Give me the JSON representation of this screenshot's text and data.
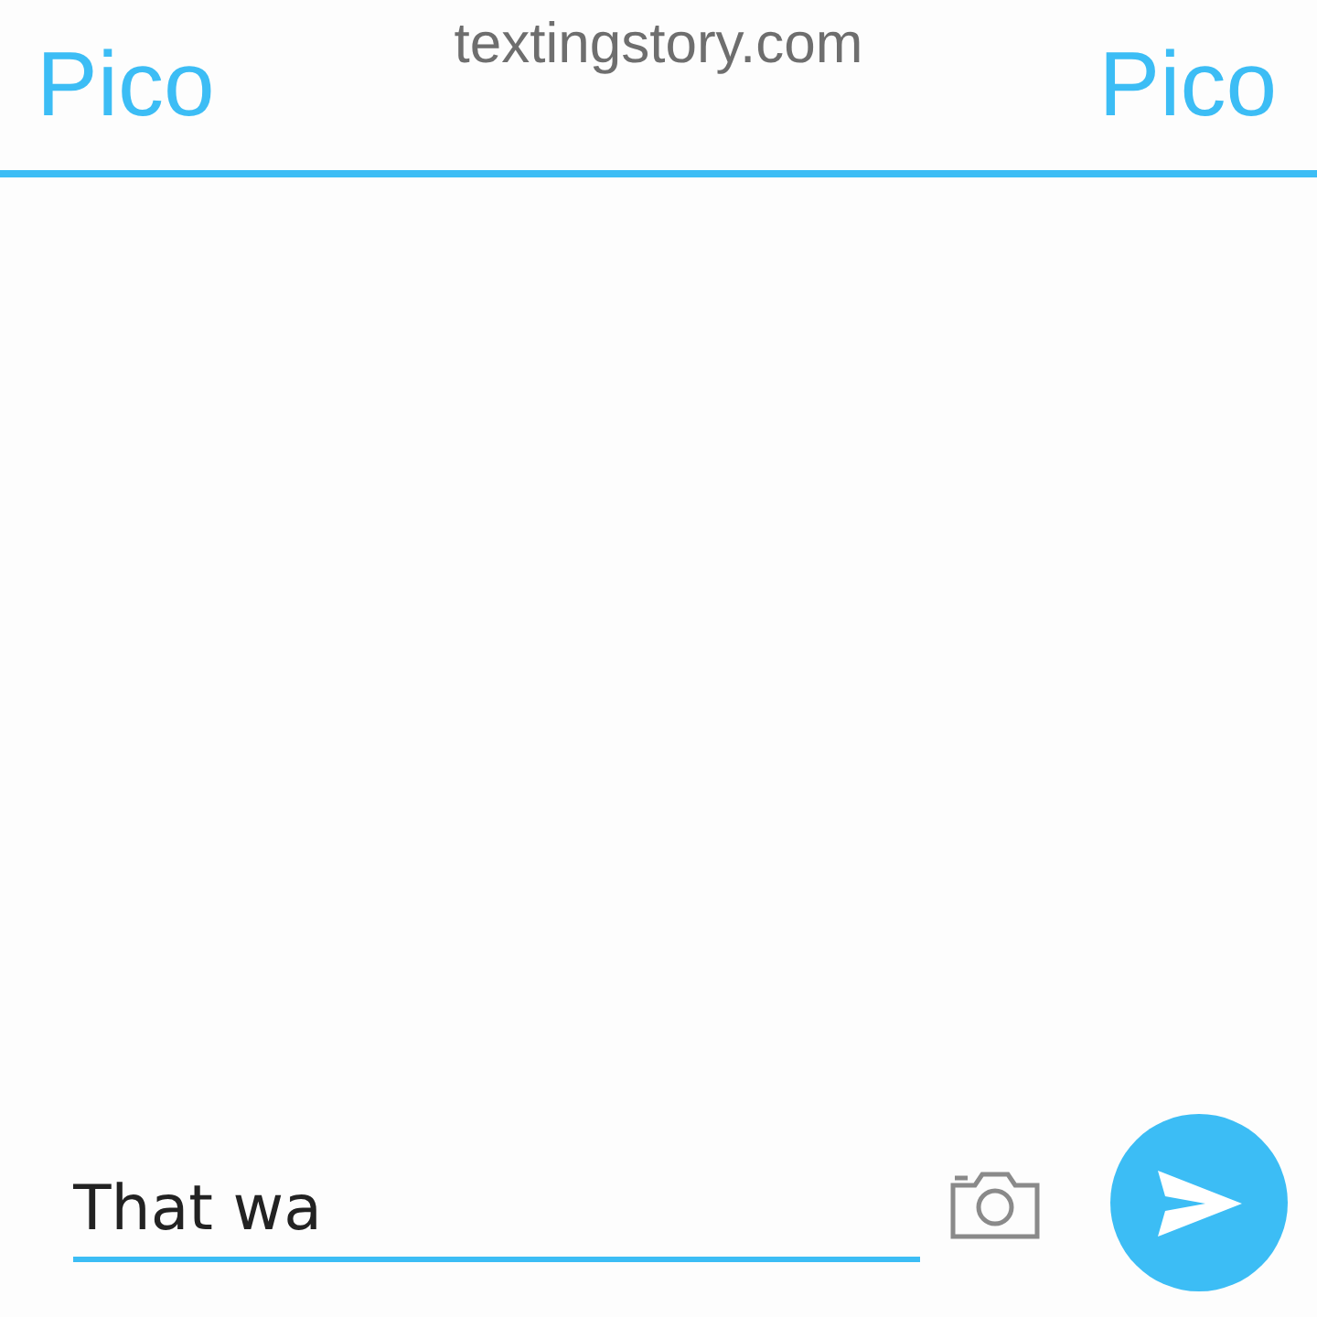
{
  "watermark": "textingstory.com",
  "header": {
    "left_name": "Pico",
    "right_name": "Pico"
  },
  "composer": {
    "value": "That wa"
  }
}
